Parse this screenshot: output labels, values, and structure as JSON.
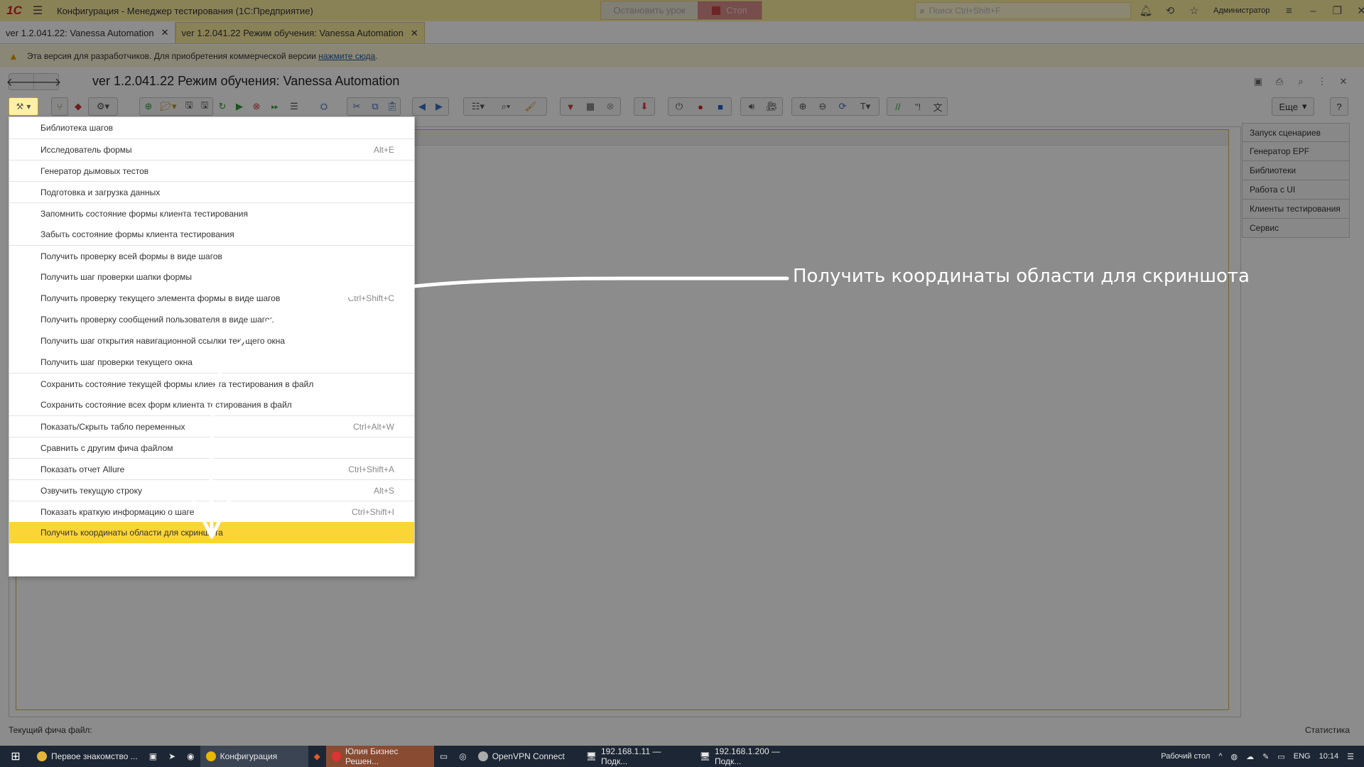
{
  "titlebar": {
    "logo": "1С",
    "title": "Конфигурация  - Менеджер тестирования (1С:Предприятие)",
    "stop_lesson": "Остановить урок",
    "stop": "Стоп",
    "search_placeholder": "Поиск Ctrl+Shift+F",
    "user": "Администратор"
  },
  "tabs": [
    {
      "label": "ver 1.2.041.22: Vanessa Automation",
      "active": false
    },
    {
      "label": "ver 1.2.041.22 Режим обучения: Vanessa Automation",
      "active": true
    }
  ],
  "banner": {
    "text": "Эта версия для разработчиков. Для приобретения коммерческой версии",
    "link": "нажмите сюда",
    "tail": "."
  },
  "form": {
    "title": "ver 1.2.041.22 Режим обучения: Vanessa Automation",
    "more_button": "Еще",
    "help_button": "?"
  },
  "menu": {
    "items": [
      {
        "label": "Библиотека шагов",
        "shortcut": ""
      },
      {
        "label": "Исследователь формы",
        "shortcut": "Alt+E"
      },
      {
        "label": "Генератор дымовых тестов",
        "shortcut": ""
      },
      {
        "label": "Подготовка и загрузка данных",
        "shortcut": ""
      },
      {
        "label": "Запомнить состояние формы клиента тестирования",
        "shortcut": ""
      },
      {
        "label": "Забыть состояние формы клиента тестирования",
        "shortcut": ""
      },
      {
        "label": "Получить проверку всей формы в виде шагов",
        "shortcut": ""
      },
      {
        "label": "Получить шаг проверки шапки формы",
        "shortcut": ""
      },
      {
        "label": "Получить проверку текущего элемента формы в виде шагов",
        "shortcut": "Ctrl+Shift+C"
      },
      {
        "label": "Получить проверку сообщений пользователя в виде шагов",
        "shortcut": ""
      },
      {
        "label": "Получить шаг открытия навигационной ссылки текущего окна",
        "shortcut": ""
      },
      {
        "label": "Получить шаг проверки текущего окна",
        "shortcut": ""
      },
      {
        "label": "Сохранить состояние текущей формы клиента тестирования в файл",
        "shortcut": ""
      },
      {
        "label": "Сохранить состояние всех форм клиента тестирования в файл",
        "shortcut": ""
      },
      {
        "label": "Показать/Скрыть табло переменных",
        "shortcut": "Ctrl+Alt+W"
      },
      {
        "label": "Сравнить с другим фича файлом",
        "shortcut": ""
      },
      {
        "label": "Показать отчет Allure",
        "shortcut": "Ctrl+Shift+A"
      },
      {
        "label": "Озвучить текущую строку",
        "shortcut": "Alt+S"
      },
      {
        "label": "Показать краткую информацию о шаге",
        "shortcut": "Ctrl+Shift+I"
      },
      {
        "label": "Получить координаты области для скриншота",
        "shortcut": ""
      }
    ]
  },
  "side_panel": {
    "items": [
      "Запуск сценариев",
      "Генератор EPF",
      "Библиотеки",
      "Работа с UI",
      "Клиенты тестирования",
      "Сервис"
    ]
  },
  "status": {
    "left": "Текущий фича файл:",
    "right": "Статистика"
  },
  "annotation": {
    "text": "Получить координаты области для скриншота"
  },
  "taskbar": {
    "items": [
      {
        "label": "Первое знакомство ...",
        "active": false
      },
      {
        "label": "Конфигурация",
        "active": true
      },
      {
        "label": "Юлия Бизнес Решен...",
        "active": false
      },
      {
        "label": "OpenVPN Connect",
        "active": false
      },
      {
        "label": "192.168.1.11 — Подк...",
        "active": false
      },
      {
        "label": "192.168.1.200 — Подк...",
        "active": false
      }
    ],
    "desktop": "Рабочий стол",
    "lang": "ENG",
    "time": "10:14"
  },
  "colors": {
    "titlebar": "#fbed9e",
    "highlight": "#fbd535",
    "taskbar": "#1c2634",
    "stop_button": "#d98d8d"
  }
}
